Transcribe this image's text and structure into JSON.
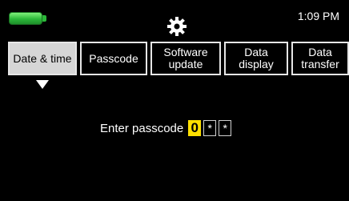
{
  "status_bar": {
    "time": "1:09 PM",
    "battery_icon": "battery-full-icon",
    "settings_icon": "gear-icon",
    "battery_color": "#2cb83a"
  },
  "tabs": [
    {
      "label": "Date & time",
      "active": true
    },
    {
      "label": "Passcode",
      "active": false
    },
    {
      "label": "Software\nupdate",
      "active": false
    },
    {
      "label": "Data\ndisplay",
      "active": false
    },
    {
      "label": "Data\ntransfer",
      "active": false
    }
  ],
  "passcode": {
    "label": "Enter passcode",
    "digits": [
      "0",
      "*",
      "*"
    ],
    "active_color": "#ffe000"
  }
}
